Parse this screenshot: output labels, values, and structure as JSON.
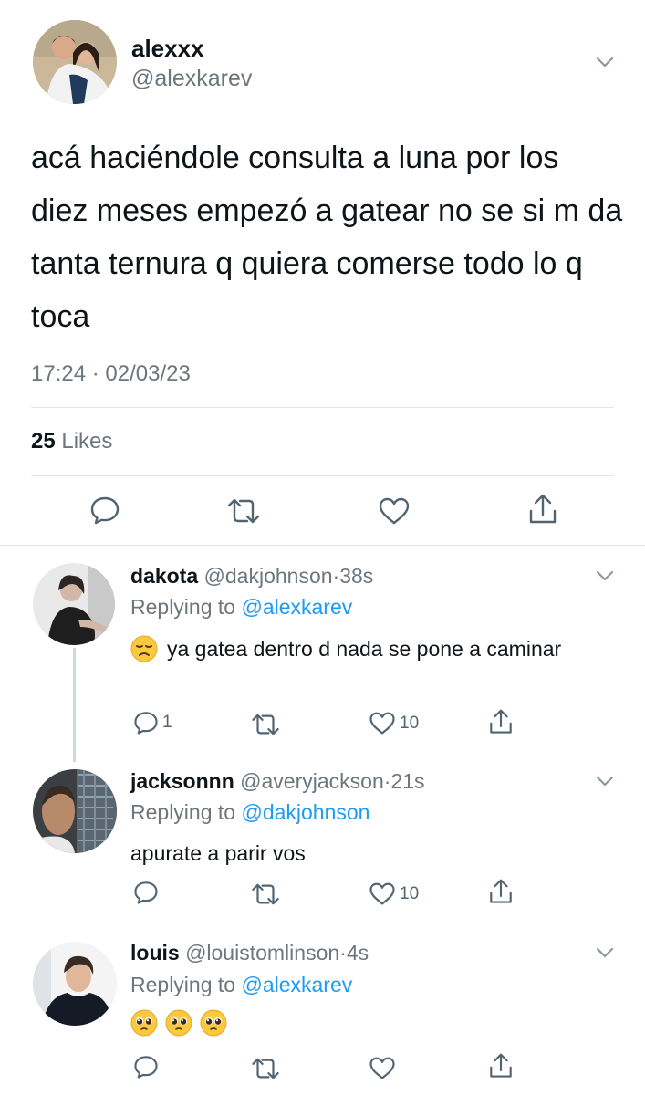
{
  "main_tweet": {
    "name": "alexxx",
    "handle": "@alexkarev",
    "text": "acá haciéndole consulta a luna por los diez meses empezó a gatear no se si m da tanta ternura q quiera comerse todo lo q toca",
    "timestamp": "17:24 · 02/03/23",
    "likes_count": "25",
    "likes_label": "Likes"
  },
  "replies": [
    {
      "name": "dakota",
      "handle": "@dakjohnson",
      "time": "38s",
      "replying_label": "Replying to",
      "replying_to": "@alexkarev",
      "emoji_name": "disappointed-face",
      "text": "ya gatea dentro d nada se pone a caminar",
      "reply_count": "1",
      "like_count": "10"
    },
    {
      "name": "jacksonnn",
      "handle": "@averyjackson",
      "time": "21s",
      "replying_label": "Replying to",
      "replying_to": "@dakjohnson",
      "text": "apurate a parir vos",
      "reply_count": "",
      "like_count": "10"
    },
    {
      "name": "louis",
      "handle": "@louistomlinson",
      "time": "4s",
      "replying_label": "Replying to",
      "replying_to": "@alexkarev",
      "emoji_name": "pleading-face",
      "text": "",
      "reply_count": "",
      "like_count": ""
    }
  ],
  "colors": {
    "link": "#1d9bf0",
    "muted": "#6e767d",
    "divider": "#e1e5e8",
    "icon": "#536471"
  }
}
